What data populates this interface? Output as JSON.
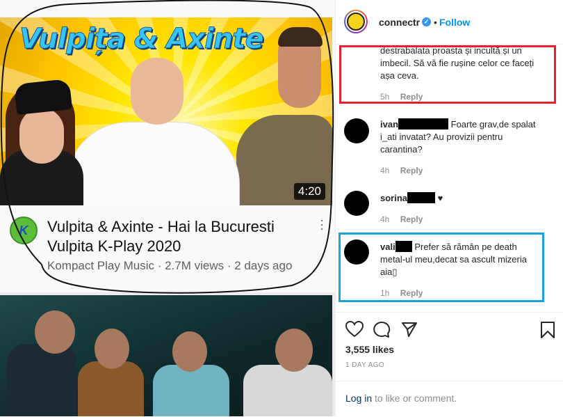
{
  "video": {
    "thumbnail_title": "Vulpița & Axinte",
    "duration": "4:20",
    "title_line1": "Vulpita & Axinte - Hai la Bucuresti",
    "title_line2": "Vulpita K-Play 2020",
    "meta": "Kompact Play Music · 2.7M views · 2 days ago",
    "channel_avatar_text": "K"
  },
  "post": {
    "username": "connectr",
    "follow_label": "Follow",
    "separator": "•",
    "verified_glyph": "✓",
    "likes": "3,555 likes",
    "age": "1 DAY AGO",
    "login_link": "Log in",
    "login_rest": "to like or comment."
  },
  "comments": [
    {
      "user": "",
      "line1": "destrabalata proasta și incultă și un",
      "line2": "imbecil. Să vă fie rușine celor ce faceți",
      "line3": "așa ceva.",
      "time": "5h",
      "reply": "Reply"
    },
    {
      "user": "ivan",
      "line1": "Foarte grav,de spalat",
      "line2": "i_ati invatat? Au provizii pentru",
      "line3": "carantina?",
      "time": "4h",
      "reply": "Reply"
    },
    {
      "user": "sorina",
      "line1": "♥",
      "time": "4h",
      "reply": "Reply"
    },
    {
      "user": "vali",
      "line1": "Prefer să rămân pe death",
      "line2": "metal-ul meu,decat sa ascult mizeria",
      "line3": "aia▯",
      "time": "1h",
      "reply": "Reply"
    }
  ],
  "icons": [
    "heart-icon",
    "comment-icon",
    "share-icon",
    "bookmark-icon",
    "verified-icon",
    "more-vert-icon"
  ],
  "colors": {
    "red_highlight": "#e6202f",
    "blue_highlight": "#1aa3dd",
    "link_blue": "#0095f6"
  }
}
